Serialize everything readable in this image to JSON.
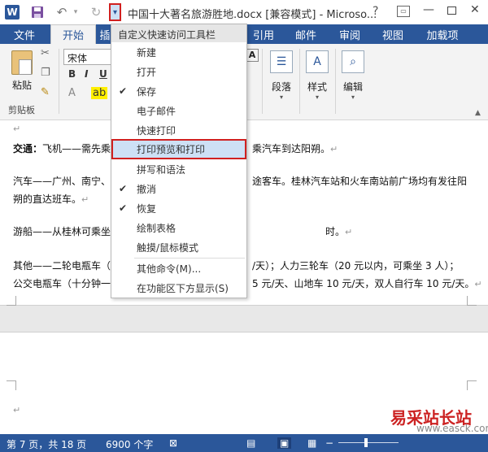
{
  "title_bar": {
    "word_logo": "W",
    "window_title": "中国十大著名旅游胜地.docx [兼容模式] - Microso...",
    "icons": [
      "word-logo-icon",
      "save-icon",
      "undo-icon",
      "redo-icon",
      "chevron-down-icon",
      "help-icon",
      "ribbon-display-icon",
      "minimize-icon",
      "maximize-icon",
      "close-icon"
    ]
  },
  "ribbon_tabs": {
    "file": "文件",
    "home": "开始",
    "home_partial": "插",
    "references": "引用",
    "mailings": "邮件",
    "review": "审阅",
    "view": "视图",
    "addins": "加载项"
  },
  "ribbon": {
    "paste_label": "粘贴",
    "clipboard_label": "剪贴板",
    "font_name": "宋体",
    "bold": "B",
    "italic": "I",
    "underline": "U",
    "paragraph_label": "段落",
    "styles_label": "样式",
    "editing_label": "编辑",
    "font_a": "A"
  },
  "qat_menu": {
    "title": "自定义快速访问工具栏",
    "items": [
      {
        "label": "新建",
        "checked": false
      },
      {
        "label": "打开",
        "checked": false
      },
      {
        "label": "保存",
        "checked": true
      },
      {
        "label": "电子邮件",
        "checked": false
      },
      {
        "label": "快速打印",
        "checked": false
      },
      {
        "label": "打印预览和打印",
        "checked": false,
        "highlighted": true
      },
      {
        "label": "拼写和语法",
        "checked": false
      },
      {
        "label": "撤消",
        "checked": true
      },
      {
        "label": "恢复",
        "checked": true
      },
      {
        "label": "绘制表格",
        "checked": false
      },
      {
        "label": "触摸/鼠标模式",
        "checked": false
      }
    ],
    "more_commands": "其他命令(M)...",
    "show_below": "在功能区下方显示(S)",
    "check_mark": "✔"
  },
  "document": {
    "para_mark": "↵",
    "line1_bold": "交通：",
    "line1_a": "飞机——需先乘",
    "line1_b": "乘汽车到达阳朔。",
    "line2_a": "汽车——广州、南宁、",
    "line2_b": "途客车。桂林汽车站和火车南站前广场均有发往阳",
    "line3": "朔的直达班车。",
    "line4_a": "游船——从桂林可乘坐",
    "line4_b": "时。",
    "line5_a": "其他——二轮电瓶车（",
    "line5_b": "/天）；人力三轮车（20 元以内，可乘坐 3 人）；",
    "line6_a": "公交电瓶车（十分钟一",
    "line6_b": "5 元/天、山地车 10 元/天，双人自行车 10 元/天。"
  },
  "status_bar": {
    "page": "第 7 页，共 18 页",
    "words": "6900 个字"
  },
  "watermark": {
    "text": "易采站长站",
    "sub": "www.easck.com"
  }
}
